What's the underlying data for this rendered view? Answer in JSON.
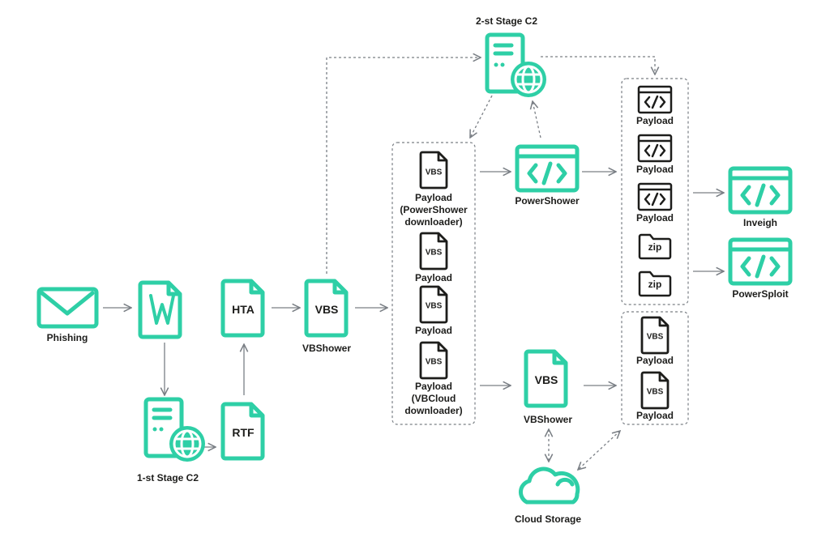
{
  "colors": {
    "accent": "#2ecfa6",
    "dark": "#1d1d1b",
    "line": "#7a7f85"
  },
  "nodes": {
    "phishing": {
      "label": "Phishing",
      "icon": "envelope-icon"
    },
    "word_doc": {
      "inner": "W",
      "icon": "word-document-icon"
    },
    "hta": {
      "inner": "HTA",
      "icon": "document-icon"
    },
    "rtf": {
      "inner": "RTF",
      "icon": "document-icon"
    },
    "c2_first": {
      "label": "1-st Stage C2",
      "icon": "server-globe-icon"
    },
    "vbshower_main": {
      "inner": "VBS",
      "label": "VBShower",
      "icon": "document-icon"
    },
    "c2_second": {
      "label": "2-st Stage C2",
      "icon": "server-globe-icon"
    },
    "powershower": {
      "label": "PowerShower",
      "icon": "code-window-icon"
    },
    "vbshower_cloud": {
      "inner": "VBS",
      "label": "VBShower",
      "icon": "document-icon"
    },
    "cloud": {
      "label": "Cloud Storage",
      "icon": "cloud-icon"
    },
    "inveigh": {
      "label": "Inveigh",
      "icon": "code-window-icon"
    },
    "powersploit": {
      "label": "PowerSploit",
      "icon": "code-window-icon"
    }
  },
  "payload_group_vbs": [
    {
      "inner": "VBS",
      "lines": [
        "Payload",
        "(PowerShower",
        "downloader)"
      ]
    },
    {
      "inner": "VBS",
      "lines": [
        "Payload"
      ]
    },
    {
      "inner": "VBS",
      "lines": [
        "Payload"
      ]
    },
    {
      "inner": "VBS",
      "lines": [
        "Payload",
        "(VBCloud",
        "downloader)"
      ]
    }
  ],
  "payload_group_ps": [
    {
      "type": "code",
      "label": "Payload"
    },
    {
      "type": "code",
      "label": "Payload"
    },
    {
      "type": "code",
      "label": "Payload"
    },
    {
      "type": "zip",
      "inner": "zip"
    },
    {
      "type": "zip",
      "inner": "zip"
    }
  ],
  "payload_group_cloud": [
    {
      "inner": "VBS",
      "label": "Payload"
    },
    {
      "inner": "VBS",
      "label": "Payload"
    }
  ]
}
